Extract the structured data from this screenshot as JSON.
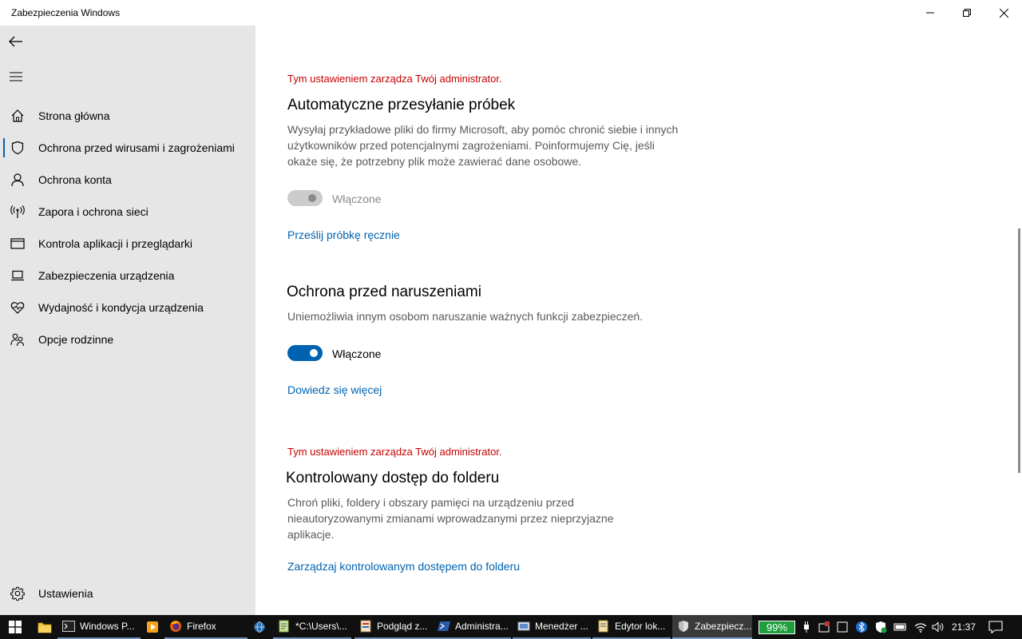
{
  "window": {
    "title": "Zabezpieczenia Windows"
  },
  "sidebar": {
    "items": [
      {
        "label": "Strona główna",
        "icon": "home-icon"
      },
      {
        "label": "Ochrona przed wirusami i zagrożeniami",
        "icon": "shield-icon",
        "selected": true
      },
      {
        "label": "Ochrona konta",
        "icon": "person-icon"
      },
      {
        "label": "Zapora i ochrona sieci",
        "icon": "antenna-icon"
      },
      {
        "label": "Kontrola aplikacji i przeglądarki",
        "icon": "app-window-icon"
      },
      {
        "label": "Zabezpieczenia urządzenia",
        "icon": "laptop-icon"
      },
      {
        "label": "Wydajność i kondycja urządzenia",
        "icon": "heart-icon"
      },
      {
        "label": "Opcje rodzinne",
        "icon": "family-icon"
      }
    ],
    "settings_label": "Ustawienia"
  },
  "main": {
    "sample_submission": {
      "admin_note": "Tym ustawieniem zarządza Twój administrator.",
      "title": "Automatyczne przesyłanie próbek",
      "description": "Wysyłaj przykładowe pliki do firmy Microsoft, aby pomóc chronić siebie i innych użytkowników przed potencjalnymi zagrożeniami. Poinformujemy Cię, jeśli okaże się, że potrzebny plik może zawierać dane osobowe.",
      "toggle_label": "Włączone",
      "toggle_on": true,
      "toggle_disabled": true,
      "link": "Prześlij próbkę ręcznie"
    },
    "tamper_protection": {
      "title": "Ochrona przed naruszeniami",
      "description": "Uniemożliwia innym osobom naruszanie ważnych funkcji zabezpieczeń.",
      "toggle_label": "Włączone",
      "toggle_on": true,
      "link": "Dowiedz się więcej"
    },
    "controlled_folder": {
      "admin_note": "Tym ustawieniem zarządza Twój administrator.",
      "title": "Kontrolowany dostęp do folderu",
      "description": "Chroń pliki, foldery i obszary pamięci na urządzeniu przed nieautoryzowanymi zmianami wprowadzanymi przez nieprzyjazne aplikacje.",
      "link": "Zarządzaj kontrolowanym dostępem do folderu"
    }
  },
  "taskbar": {
    "apps": [
      {
        "label": "Windows P...",
        "icon": "terminal-icon"
      },
      {
        "label": "Firefox",
        "icon": "firefox-icon"
      },
      {
        "label": "*C:\\Users\\...",
        "icon": "notepad-icon"
      },
      {
        "label": "Podgląd z...",
        "icon": "event-viewer-icon"
      },
      {
        "label": "Administra...",
        "icon": "powershell-icon"
      },
      {
        "label": "Menedżer ...",
        "icon": "manager-icon"
      },
      {
        "label": "Edytor lok...",
        "icon": "editor-icon"
      },
      {
        "label": "Zabezpiecz...",
        "icon": "security-shield-icon"
      }
    ],
    "battery": "99%",
    "clock": "21:37"
  },
  "colors": {
    "accent": "#0063b1",
    "admin_warning": "#c50000",
    "sidebar_bg": "#e6e6e6",
    "battery_green": "#1f9e3e"
  }
}
